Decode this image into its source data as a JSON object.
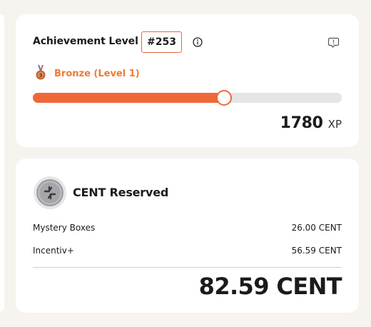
{
  "achievement": {
    "title": "Achievement Level",
    "rank": "#253",
    "level_label": "Bronze (Level 1)",
    "progress_fraction": 0.62,
    "xp_value": "1780",
    "xp_unit": "XP",
    "icons": {
      "info": "info-circle-icon",
      "report": "report-icon",
      "medal": "bronze-medal-icon"
    }
  },
  "cent": {
    "title": "CENT Reserved",
    "rows": [
      {
        "label": "Mystery Boxes",
        "value": "26.00 CENT"
      },
      {
        "label": "Incentiv+",
        "value": "56.59 CENT"
      }
    ],
    "total": "82.59 CENT",
    "icons": {
      "coin": "cent-coin-icon"
    }
  },
  "colors": {
    "accent": "#f0683a",
    "text": "#1b1b1b",
    "background": "#f7f3ef",
    "card": "#ffffff"
  }
}
